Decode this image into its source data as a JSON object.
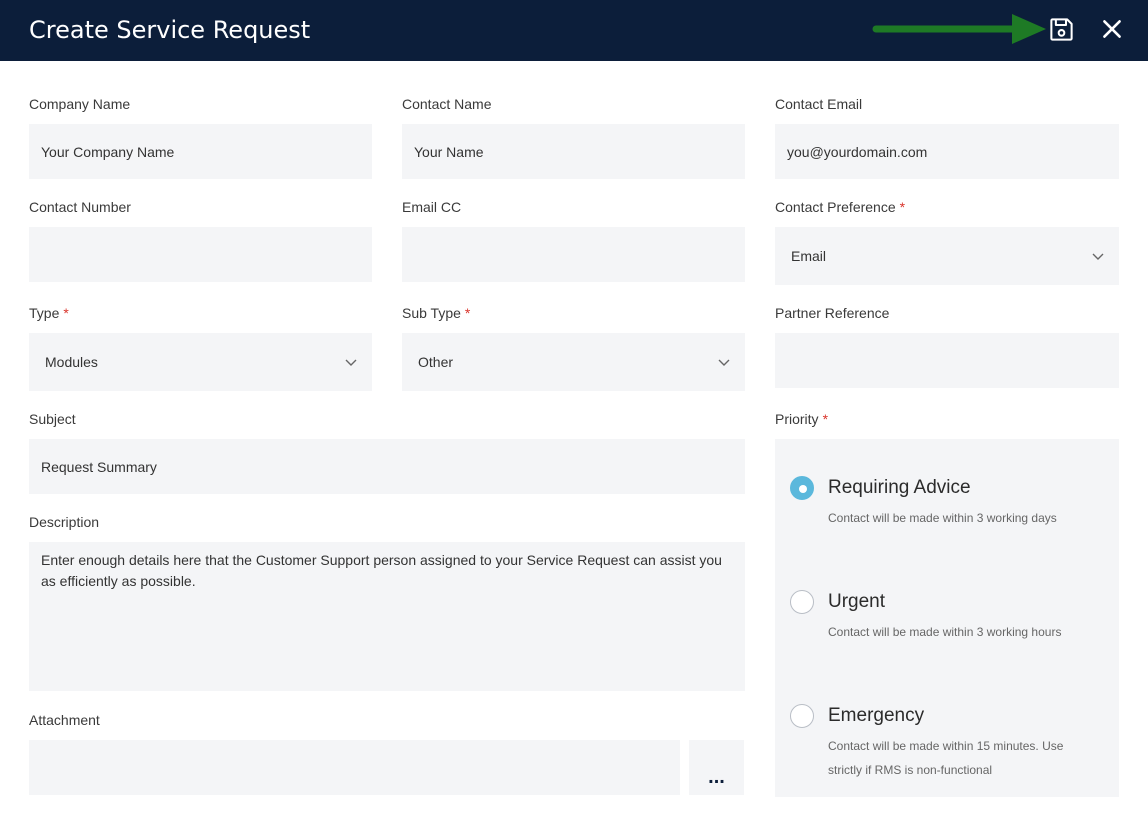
{
  "header": {
    "title": "Create Service Request",
    "accent_color": "#0c1e3a",
    "arrow_color": "#1e7a25",
    "save_icon": "save-icon",
    "close_icon": "close-icon"
  },
  "fields": {
    "company_name": {
      "label": "Company Name",
      "value": "Your Company Name"
    },
    "contact_name": {
      "label": "Contact Name",
      "value": "Your Name"
    },
    "contact_email": {
      "label": "Contact Email",
      "value": "you@yourdomain.com"
    },
    "contact_number": {
      "label": "Contact Number",
      "value": ""
    },
    "email_cc": {
      "label": "Email CC",
      "value": ""
    },
    "contact_preference": {
      "label": "Contact Preference",
      "value": "Email",
      "required": true
    },
    "type": {
      "label": "Type",
      "value": "Modules",
      "required": true
    },
    "sub_type": {
      "label": "Sub Type",
      "value": "Other",
      "required": true
    },
    "partner_reference": {
      "label": "Partner Reference",
      "value": ""
    },
    "subject": {
      "label": "Subject",
      "value": "Request Summary"
    },
    "description": {
      "label": "Description",
      "value": "Enter enough details here that the Customer Support person assigned to your Service Request can assist you as efficiently as possible."
    },
    "attachment": {
      "label": "Attachment",
      "value": "",
      "browse_label": "..."
    }
  },
  "required_marker": "*",
  "priority": {
    "label": "Priority",
    "required": true,
    "selected_color": "#5bb8dc",
    "options": [
      {
        "label": "Requiring Advice",
        "description": "Contact will be made within 3 working days",
        "selected": true
      },
      {
        "label": "Urgent",
        "description": "Contact will be made within 3 working hours",
        "selected": false
      },
      {
        "label": "Emergency",
        "description": "Contact will be made within 15 minutes. Use strictly if RMS is non-functional",
        "selected": false
      }
    ]
  }
}
